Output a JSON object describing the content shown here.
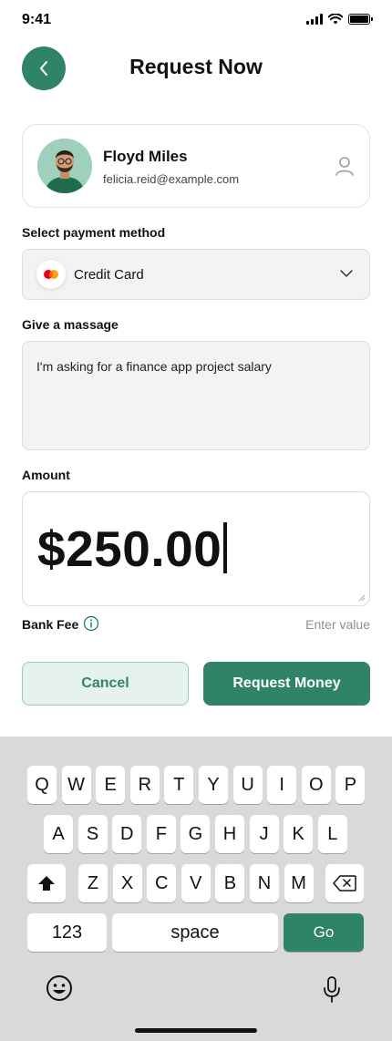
{
  "status": {
    "time": "9:41"
  },
  "header": {
    "title": "Request Now",
    "back_icon": "chevron-left-icon"
  },
  "recipient": {
    "name": "Floyd Miles",
    "email": "felicia.reid@example.com",
    "avatar": "avatar-photo",
    "action_icon": "user-icon"
  },
  "payment": {
    "label": "Select payment method",
    "selected": "Credit Card",
    "icon": "mastercard-icon"
  },
  "message": {
    "label": "Give a massage",
    "value": "I'm asking for a finance app project salary"
  },
  "amount": {
    "label": "Amount",
    "value": "$250.00"
  },
  "bank_fee": {
    "label": "Bank Fee",
    "placeholder": "Enter value",
    "icon": "info-icon"
  },
  "actions": {
    "cancel_label": "Cancel",
    "request_label": "Request Money"
  },
  "keyboard": {
    "row1": [
      "Q",
      "W",
      "E",
      "R",
      "T",
      "Y",
      "U",
      "I",
      "O",
      "P"
    ],
    "row2": [
      "A",
      "S",
      "D",
      "F",
      "G",
      "H",
      "J",
      "K",
      "L"
    ],
    "row3": [
      "Z",
      "X",
      "C",
      "V",
      "B",
      "N",
      "M"
    ],
    "numbers_label": "123",
    "space_label": "space",
    "go_label": "Go"
  },
  "colors": {
    "accent": "#2f8465",
    "accent_light": "#e6f2ec",
    "field_bg": "#f3f3f3",
    "keyboard_bg": "#d9d9d9"
  }
}
